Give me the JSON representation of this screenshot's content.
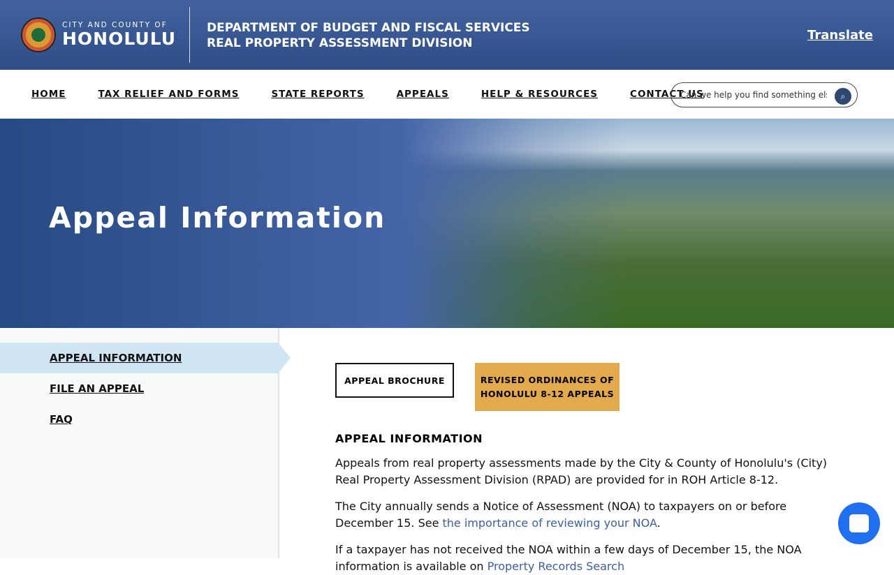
{
  "header": {
    "city_small": "CITY AND COUNTY OF",
    "city_big": "HONOLULU",
    "dept_line1": "DEPARTMENT OF BUDGET AND FISCAL SERVICES",
    "dept_line2": "REAL PROPERTY ASSESSMENT DIVISION",
    "translate": "Translate"
  },
  "nav": {
    "items": [
      "HOME",
      "TAX RELIEF AND FORMS",
      "STATE REPORTS",
      "APPEALS",
      "HELP & RESOURCES",
      "CONTACT US"
    ],
    "search_placeholder": "Can we help you find something else?"
  },
  "hero": {
    "title": "Appeal Information"
  },
  "sidebar": {
    "items": [
      "APPEAL INFORMATION",
      "FILE AN APPEAL",
      "FAQ"
    ]
  },
  "main": {
    "btn1": "APPEAL BROCHURE",
    "btn2": "REVISED ORDINANCES OF HONOLULU 8-12 APPEALS",
    "heading": "APPEAL INFORMATION",
    "p1": "Appeals from real property assessments made by the City & County of Honolulu's (City) Real Property Assessment Division (RPAD) are provided for in ROH Article 8-12.",
    "p2_text": "The City annually sends a Notice of Assessment (NOA) to taxpayers on or before December 15.  See ",
    "p2_link": "the importance of reviewing your NOA",
    "p2_end": ".",
    "p3_text": "If a taxpayer has not received the NOA within a few days of December 15, the NOA information is available on ",
    "p3_link": "Property Records Search"
  }
}
